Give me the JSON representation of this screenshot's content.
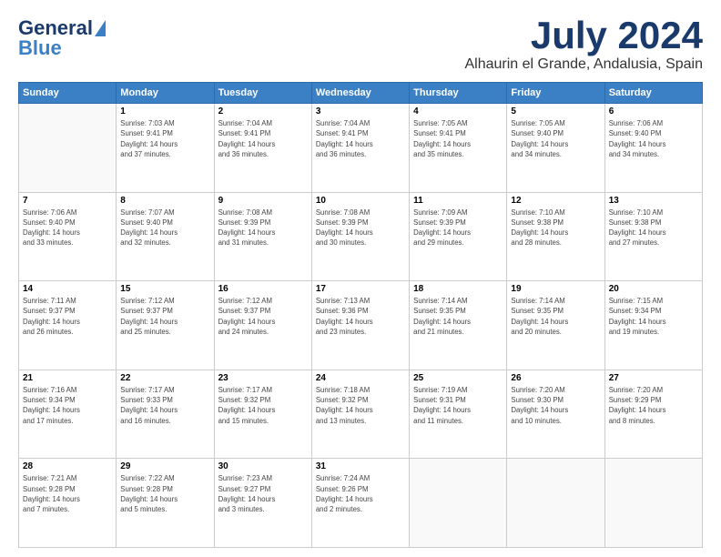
{
  "header": {
    "logo_line1": "General",
    "logo_line2": "Blue",
    "month": "July 2024",
    "location": "Alhaurin el Grande, Andalusia, Spain"
  },
  "weekdays": [
    "Sunday",
    "Monday",
    "Tuesday",
    "Wednesday",
    "Thursday",
    "Friday",
    "Saturday"
  ],
  "weeks": [
    [
      {
        "day": "",
        "info": ""
      },
      {
        "day": "1",
        "info": "Sunrise: 7:03 AM\nSunset: 9:41 PM\nDaylight: 14 hours\nand 37 minutes."
      },
      {
        "day": "2",
        "info": "Sunrise: 7:04 AM\nSunset: 9:41 PM\nDaylight: 14 hours\nand 36 minutes."
      },
      {
        "day": "3",
        "info": "Sunrise: 7:04 AM\nSunset: 9:41 PM\nDaylight: 14 hours\nand 36 minutes."
      },
      {
        "day": "4",
        "info": "Sunrise: 7:05 AM\nSunset: 9:41 PM\nDaylight: 14 hours\nand 35 minutes."
      },
      {
        "day": "5",
        "info": "Sunrise: 7:05 AM\nSunset: 9:40 PM\nDaylight: 14 hours\nand 34 minutes."
      },
      {
        "day": "6",
        "info": "Sunrise: 7:06 AM\nSunset: 9:40 PM\nDaylight: 14 hours\nand 34 minutes."
      }
    ],
    [
      {
        "day": "7",
        "info": "Sunrise: 7:06 AM\nSunset: 9:40 PM\nDaylight: 14 hours\nand 33 minutes."
      },
      {
        "day": "8",
        "info": "Sunrise: 7:07 AM\nSunset: 9:40 PM\nDaylight: 14 hours\nand 32 minutes."
      },
      {
        "day": "9",
        "info": "Sunrise: 7:08 AM\nSunset: 9:39 PM\nDaylight: 14 hours\nand 31 minutes."
      },
      {
        "day": "10",
        "info": "Sunrise: 7:08 AM\nSunset: 9:39 PM\nDaylight: 14 hours\nand 30 minutes."
      },
      {
        "day": "11",
        "info": "Sunrise: 7:09 AM\nSunset: 9:39 PM\nDaylight: 14 hours\nand 29 minutes."
      },
      {
        "day": "12",
        "info": "Sunrise: 7:10 AM\nSunset: 9:38 PM\nDaylight: 14 hours\nand 28 minutes."
      },
      {
        "day": "13",
        "info": "Sunrise: 7:10 AM\nSunset: 9:38 PM\nDaylight: 14 hours\nand 27 minutes."
      }
    ],
    [
      {
        "day": "14",
        "info": "Sunrise: 7:11 AM\nSunset: 9:37 PM\nDaylight: 14 hours\nand 26 minutes."
      },
      {
        "day": "15",
        "info": "Sunrise: 7:12 AM\nSunset: 9:37 PM\nDaylight: 14 hours\nand 25 minutes."
      },
      {
        "day": "16",
        "info": "Sunrise: 7:12 AM\nSunset: 9:37 PM\nDaylight: 14 hours\nand 24 minutes."
      },
      {
        "day": "17",
        "info": "Sunrise: 7:13 AM\nSunset: 9:36 PM\nDaylight: 14 hours\nand 23 minutes."
      },
      {
        "day": "18",
        "info": "Sunrise: 7:14 AM\nSunset: 9:35 PM\nDaylight: 14 hours\nand 21 minutes."
      },
      {
        "day": "19",
        "info": "Sunrise: 7:14 AM\nSunset: 9:35 PM\nDaylight: 14 hours\nand 20 minutes."
      },
      {
        "day": "20",
        "info": "Sunrise: 7:15 AM\nSunset: 9:34 PM\nDaylight: 14 hours\nand 19 minutes."
      }
    ],
    [
      {
        "day": "21",
        "info": "Sunrise: 7:16 AM\nSunset: 9:34 PM\nDaylight: 14 hours\nand 17 minutes."
      },
      {
        "day": "22",
        "info": "Sunrise: 7:17 AM\nSunset: 9:33 PM\nDaylight: 14 hours\nand 16 minutes."
      },
      {
        "day": "23",
        "info": "Sunrise: 7:17 AM\nSunset: 9:32 PM\nDaylight: 14 hours\nand 15 minutes."
      },
      {
        "day": "24",
        "info": "Sunrise: 7:18 AM\nSunset: 9:32 PM\nDaylight: 14 hours\nand 13 minutes."
      },
      {
        "day": "25",
        "info": "Sunrise: 7:19 AM\nSunset: 9:31 PM\nDaylight: 14 hours\nand 11 minutes."
      },
      {
        "day": "26",
        "info": "Sunrise: 7:20 AM\nSunset: 9:30 PM\nDaylight: 14 hours\nand 10 minutes."
      },
      {
        "day": "27",
        "info": "Sunrise: 7:20 AM\nSunset: 9:29 PM\nDaylight: 14 hours\nand 8 minutes."
      }
    ],
    [
      {
        "day": "28",
        "info": "Sunrise: 7:21 AM\nSunset: 9:28 PM\nDaylight: 14 hours\nand 7 minutes."
      },
      {
        "day": "29",
        "info": "Sunrise: 7:22 AM\nSunset: 9:28 PM\nDaylight: 14 hours\nand 5 minutes."
      },
      {
        "day": "30",
        "info": "Sunrise: 7:23 AM\nSunset: 9:27 PM\nDaylight: 14 hours\nand 3 minutes."
      },
      {
        "day": "31",
        "info": "Sunrise: 7:24 AM\nSunset: 9:26 PM\nDaylight: 14 hours\nand 2 minutes."
      },
      {
        "day": "",
        "info": ""
      },
      {
        "day": "",
        "info": ""
      },
      {
        "day": "",
        "info": ""
      }
    ]
  ]
}
